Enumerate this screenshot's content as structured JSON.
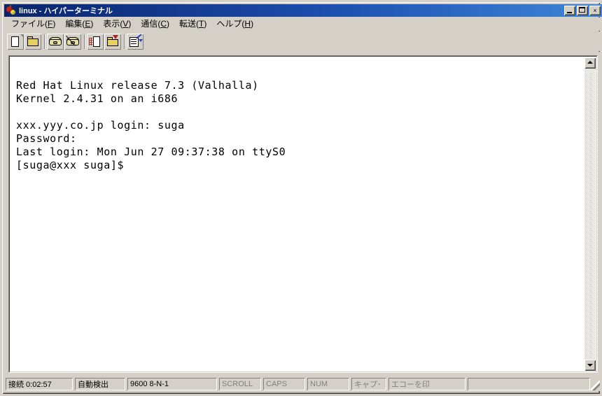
{
  "window": {
    "title": "linux - ハイパーターミナル",
    "icon": "hyperterminal-icon",
    "minimize_label": "最小化",
    "maximize_label": "最大化",
    "close_label": "×"
  },
  "menu": {
    "items": [
      {
        "label": "ファイル(F)",
        "text": "ファイル(",
        "mnemonic": "F",
        "tail": ")",
        "name": "menu-file"
      },
      {
        "label": "編集(E)",
        "text": "編集(",
        "mnemonic": "E",
        "tail": ")",
        "name": "menu-edit"
      },
      {
        "label": "表示(V)",
        "text": "表示(",
        "mnemonic": "V",
        "tail": ")",
        "name": "menu-view"
      },
      {
        "label": "通信(C)",
        "text": "通信(",
        "mnemonic": "C",
        "tail": ")",
        "name": "menu-call"
      },
      {
        "label": "転送(T)",
        "text": "転送(",
        "mnemonic": "T",
        "tail": ")",
        "name": "menu-transfer"
      },
      {
        "label": "ヘルプ(H)",
        "text": "ヘルプ(",
        "mnemonic": "H",
        "tail": ")",
        "name": "menu-help"
      }
    ]
  },
  "toolbar": {
    "buttons": [
      {
        "icon": "new-document-icon",
        "name": "new-connection-button"
      },
      {
        "icon": "open-folder-icon",
        "name": "open-connection-button"
      },
      {
        "icon": "phone-dial-icon",
        "name": "call-button"
      },
      {
        "icon": "phone-hangup-icon",
        "name": "disconnect-button"
      },
      {
        "icon": "send-file-icon",
        "name": "send-file-button"
      },
      {
        "icon": "receive-file-icon",
        "name": "receive-file-button"
      },
      {
        "icon": "properties-icon",
        "name": "properties-button"
      }
    ]
  },
  "terminal": {
    "lines": [
      "Red Hat Linux release 7.3 (Valhalla)",
      "Kernel 2.4.31 on an i686",
      "",
      "xxx.yyy.co.jp login: suga",
      "Password:",
      "Last login: Mon Jun 27 09:37:38 on ttyS0",
      "[suga@xxx suga]$"
    ],
    "text": "Red Hat Linux release 7.3 (Valhalla)\nKernel 2.4.31 on an i686\n\nxxx.yyy.co.jp login: suga\nPassword:\nLast login: Mon Jun 27 09:37:38 on ttyS0\n[suga@xxx suga]$",
    "background_color": "#ffffff",
    "text_color": "#000000"
  },
  "scrollbar": {
    "up_arrow": "scroll-up-icon",
    "down_arrow": "scroll-down-icon"
  },
  "statusbar": {
    "connection": "接続 0:02:57",
    "detection": "自動検出",
    "line_settings": "9600 8-N-1",
    "scroll": "SCROLL",
    "caps": "CAPS",
    "num": "NUM",
    "capture": "キャプ･",
    "echo": "エコーを印"
  },
  "colors": {
    "titlebar_start": "#0a246a",
    "titlebar_end": "#3f86d8",
    "window_face": "#d4d0c8",
    "terminal_bg": "#ffffff",
    "disabled_text": "#808080"
  }
}
